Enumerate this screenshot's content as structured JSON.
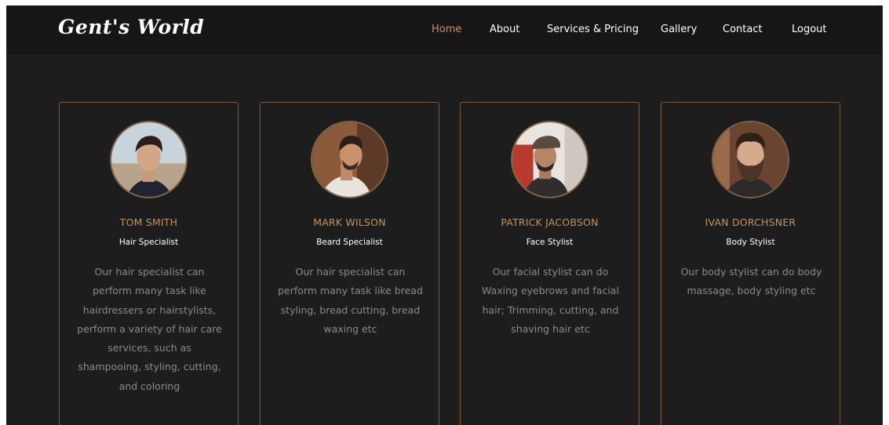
{
  "brand": {
    "logo": "Gent's World"
  },
  "nav": {
    "items": [
      {
        "label": "Home",
        "active": true
      },
      {
        "label": "About",
        "active": false
      },
      {
        "label": "Services & Pricing",
        "active": false
      },
      {
        "label": "Gallery",
        "active": false
      },
      {
        "label": "Contact",
        "active": false
      },
      {
        "label": "Logout",
        "active": false
      }
    ]
  },
  "colors": {
    "background": "#1d1d1d",
    "navbar": "#161616",
    "accent": "#c8915a",
    "card_border": "#7a5a36",
    "text": "#ffffff",
    "muted_text": "#8a8a8a"
  },
  "team": [
    {
      "name": "TOM SMITH",
      "role": "Hair Specialist",
      "description": "Our hair specialist can perform many task like hairdressers or hairstylists, perform a variety of hair care services, such as shampooing, styling, cutting, and coloring",
      "photo": "profile-photo"
    },
    {
      "name": "MARK WILSON",
      "role": "Beard Specialist",
      "description": "Our hair specialist can perform many task like bread styling, bread cutting, bread waxing etc",
      "photo": "profile-photo"
    },
    {
      "name": "PATRICK JACOBSON",
      "role": "Face Stylist",
      "description": "Our facial stylist can do Waxing eyebrows and facial hair; Trimming, cutting, and shaving hair etc",
      "photo": "profile-photo"
    },
    {
      "name": "IVAN DORCHSNER",
      "role": "Body Stylist",
      "description": "Our body stylist can do body massage, body styling etc",
      "photo": "profile-photo"
    }
  ]
}
